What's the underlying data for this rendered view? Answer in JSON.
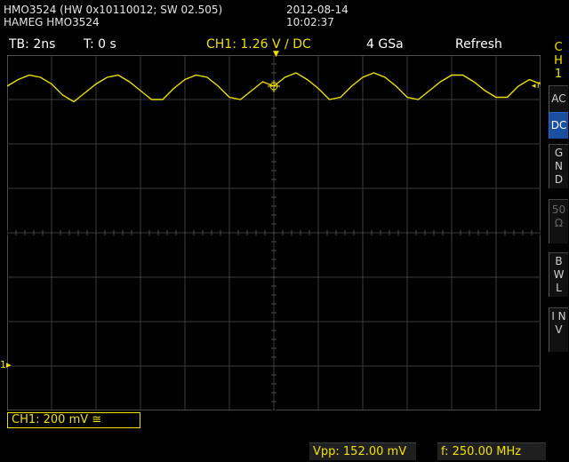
{
  "header": {
    "model_line": "HMO3524 (HW 0x10110012; SW 02.505)",
    "brand_line": "HAMEG HMO3524",
    "date": "2012-08-14",
    "time": "10:02:37"
  },
  "topbar": {
    "timebase": "TB: 2ns",
    "trigger_time": "T: 0 s",
    "ch1_trigger": "CH1: 1.26 V ∕ DC",
    "sample_rate": "4 GSa",
    "mode": "Refresh"
  },
  "sidebar": {
    "title_chars": [
      "C",
      "H",
      "1"
    ],
    "buttons": [
      {
        "label": "AC",
        "active": false
      },
      {
        "label": "DC",
        "active": true
      },
      {
        "label": "G N D",
        "active": false
      },
      {
        "label": "50 Ω",
        "active": false
      },
      {
        "label": "B W L",
        "active": false
      },
      {
        "label": "I N V",
        "active": false
      }
    ]
  },
  "channel_box": {
    "text": "CH1: 200 mV ≅"
  },
  "measurements": {
    "vpp": "Vpp: 152.00 mV",
    "freq": "f: 250.00 MHz"
  },
  "markers": {
    "ground": "1",
    "trigger_right": "T"
  },
  "colors": {
    "trace": "#f0e000",
    "grid": "#3a3a3a",
    "active_button": "#1a4fa0"
  },
  "chart_data": {
    "type": "line",
    "title": "",
    "xlabel": "",
    "ylabel": "",
    "divisions_x": 12,
    "divisions_y": 8,
    "xlim": [
      -12,
      12
    ],
    "ylim": [
      -0.8,
      0.8
    ],
    "series": [
      {
        "values_x": [
          -12,
          -11.5,
          -11,
          -10.5,
          -10,
          -9.5,
          -9,
          -8.5,
          -8,
          -7.5,
          -7,
          -6.5,
          -6,
          -5.5,
          -5,
          -4.5,
          -4,
          -3.5,
          -3,
          -2.5,
          -2,
          -1.5,
          -1,
          -0.5,
          0,
          0.5,
          1,
          1.5,
          2,
          2.5,
          3,
          3.5,
          4,
          4.5,
          5,
          5.5,
          6,
          6.5,
          7,
          7.5,
          8,
          8.5,
          9,
          9.5,
          10,
          10.5,
          11,
          11.5,
          12
        ],
        "values_y": [
          0.66,
          0.69,
          0.71,
          0.7,
          0.67,
          0.62,
          0.59,
          0.63,
          0.67,
          0.7,
          0.71,
          0.68,
          0.64,
          0.6,
          0.6,
          0.65,
          0.69,
          0.71,
          0.7,
          0.66,
          0.61,
          0.6,
          0.64,
          0.68,
          0.66,
          0.7,
          0.72,
          0.69,
          0.65,
          0.6,
          0.61,
          0.66,
          0.7,
          0.72,
          0.7,
          0.66,
          0.61,
          0.6,
          0.64,
          0.68,
          0.71,
          0.71,
          0.68,
          0.64,
          0.61,
          0.61,
          0.66,
          0.69,
          0.67
        ]
      }
    ]
  }
}
